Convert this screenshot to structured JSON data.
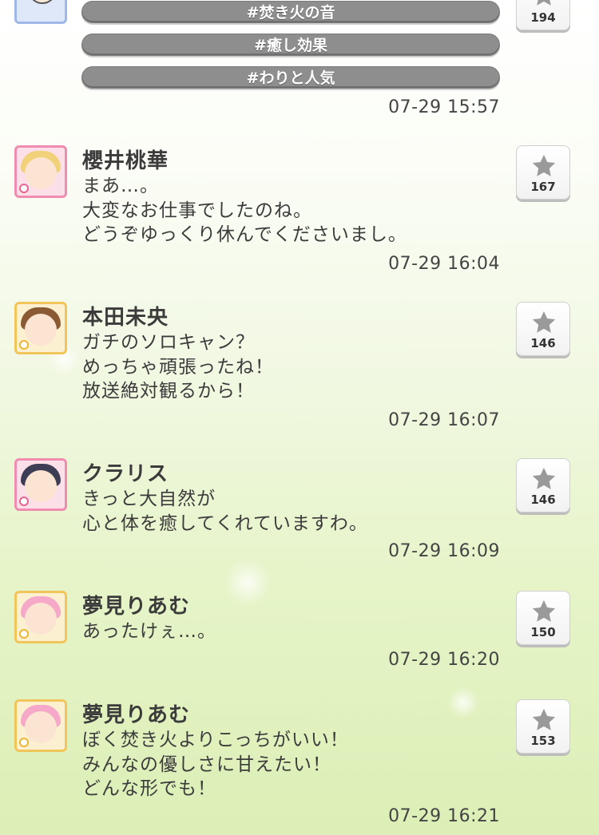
{
  "top_post": {
    "hashtags": [
      "#焚き火の音",
      "#癒し効果",
      "#わりと人気"
    ],
    "time": "07-29 15:57",
    "likes": "194"
  },
  "posts": [
    {
      "name": "櫻井桃華",
      "lines": [
        "まあ…。",
        "大変なお仕事でしたのね。",
        "どうぞゆっくり休んでくださいまし。"
      ],
      "time": "07-29 16:04",
      "likes": "167"
    },
    {
      "name": "本田未央",
      "lines": [
        "ガチのソロキャン？",
        "めっちゃ頑張ったね！",
        "放送絶対観るから！"
      ],
      "time": "07-29 16:07",
      "likes": "146"
    },
    {
      "name": "クラリス",
      "lines": [
        "きっと大自然が",
        "心と体を癒してくれていますわ。"
      ],
      "time": "07-29 16:09",
      "likes": "146"
    },
    {
      "name": "夢見りあむ",
      "lines": [
        "あったけぇ…。"
      ],
      "time": "07-29 16:20",
      "likes": "150"
    },
    {
      "name": "夢見りあむ",
      "lines": [
        "ぼく焚き火よりこっちがいい！",
        "みんなの優しさに甘えたい！",
        "どんな形でも！"
      ],
      "time": "07-29 16:21",
      "likes": "153"
    }
  ],
  "icons": {
    "like": "star-icon",
    "avatar": "idol-avatar"
  }
}
